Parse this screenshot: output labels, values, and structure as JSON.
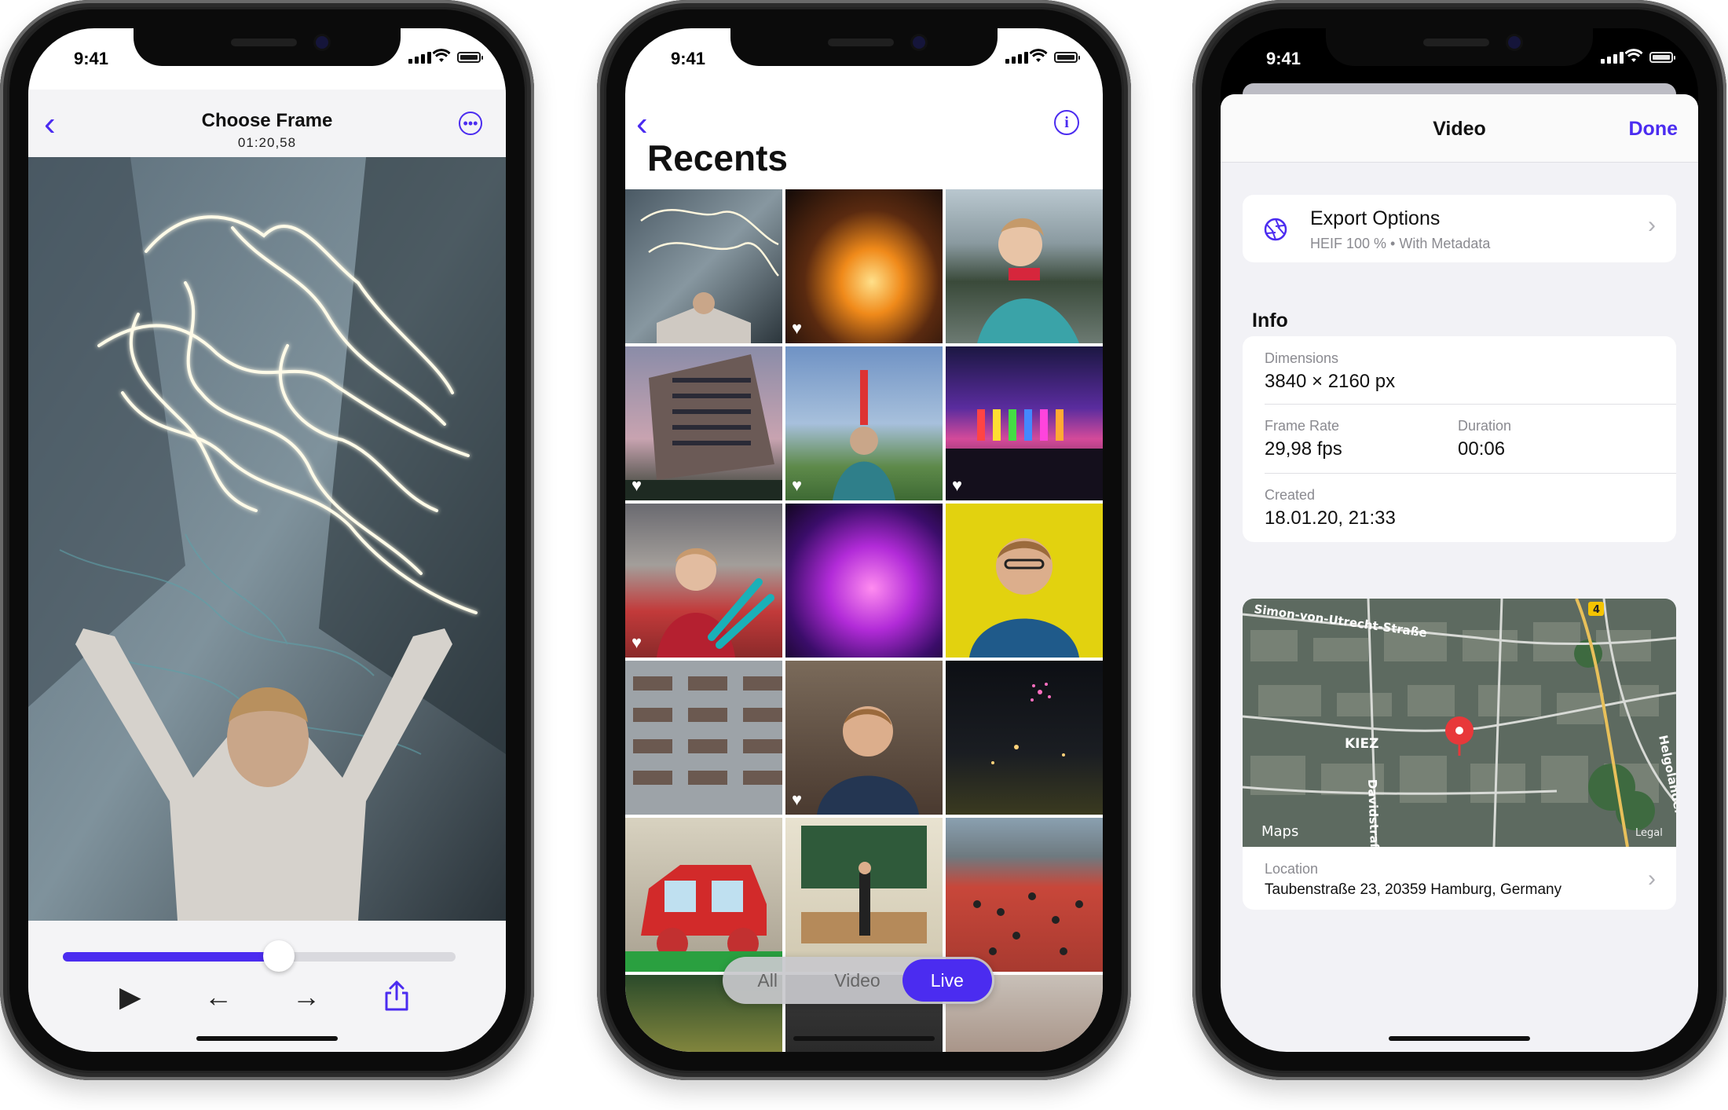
{
  "status": {
    "time": "9:41"
  },
  "phone1": {
    "title": "Choose Frame",
    "timecode": "01:20,58",
    "progress": 0.55,
    "accent": "#4b2cf0"
  },
  "phone2": {
    "title": "Recents",
    "segments": [
      {
        "label": "All",
        "active": false
      },
      {
        "label": "Video",
        "active": false
      },
      {
        "label": "Live",
        "active": true
      }
    ]
  },
  "phone3": {
    "sheet_title": "Video",
    "done_label": "Done",
    "export": {
      "title": "Export Options",
      "subtitle": "HEIF 100 % • With Metadata"
    },
    "info_header": "Info",
    "dimensions": {
      "label": "Dimensions",
      "value": "3840 × 2160 px"
    },
    "frame_rate": {
      "label": "Frame Rate",
      "value": "29,98 fps"
    },
    "duration": {
      "label": "Duration",
      "value": "00:06"
    },
    "created": {
      "label": "Created",
      "value": "18.01.20, 21:33"
    },
    "map": {
      "street_top": "Simon-von-Utrecht-Straße",
      "district": "KIEZ",
      "street_vertical": "Davidstraße",
      "street_right": "Helgoländer",
      "brand": "Maps",
      "legal": "Legal",
      "badge": "4"
    },
    "location": {
      "label": "Location",
      "value": "Taubenstraße 23, 20359 Hamburg, Germany"
    }
  }
}
